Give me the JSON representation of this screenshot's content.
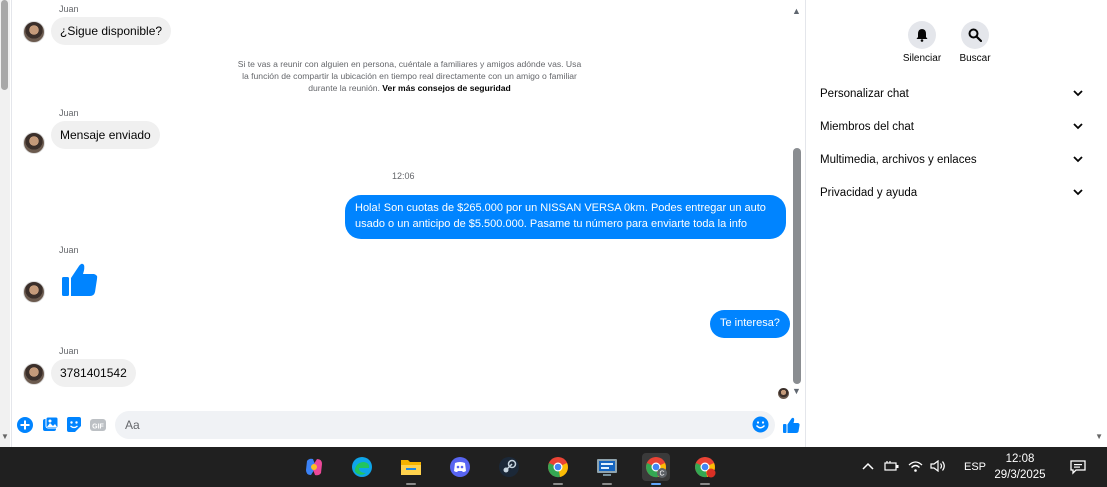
{
  "chat": {
    "messages": [
      {
        "sender": "Juan",
        "text": "¿Sigue disponible?"
      },
      {
        "sender": "Juan",
        "text": "Mensaje enviado"
      },
      {
        "sender": "Juan",
        "text": "3781401542"
      }
    ],
    "liked_sender": "Juan",
    "notice_text": "Si te vas a reunir con alguien en persona, cuéntale a familiares y amigos adónde vas. Usa la función de compartir la ubicación en tiempo real directamente con un amigo o familiar durante la reunión.",
    "notice_link": "Ver más consejos de seguridad",
    "timestamp": "12:06",
    "outgoing": [
      {
        "text": "Hola! Son cuotas de $265.000 por un NISSAN VERSA 0km. Podes entregar un auto usado o un anticipo de $5.500.000. Pasame tu número para enviarte toda la info"
      },
      {
        "text": "Te interesa?"
      }
    ],
    "composer_placeholder": "Aa"
  },
  "side": {
    "mute_label": "Silenciar",
    "search_label": "Buscar",
    "sections": [
      {
        "label": "Personalizar chat"
      },
      {
        "label": "Miembros del chat"
      },
      {
        "label": "Multimedia, archivos y enlaces"
      },
      {
        "label": "Privacidad y ayuda"
      }
    ]
  },
  "taskbar": {
    "language": "ESP",
    "time": "12:08",
    "date": "29/3/2025",
    "apps": [
      "copilot-icon",
      "edge-icon",
      "file-explorer-icon",
      "discord-icon",
      "steam-icon",
      "chrome-icon",
      "control-panel-icon",
      "chrome-profile-c-icon",
      "chrome-icon"
    ],
    "chrome_profile_letter": "C"
  },
  "colors": {
    "accent": "#0084ff",
    "bubble_in": "#f0f0f0",
    "taskbar": "#202020"
  }
}
